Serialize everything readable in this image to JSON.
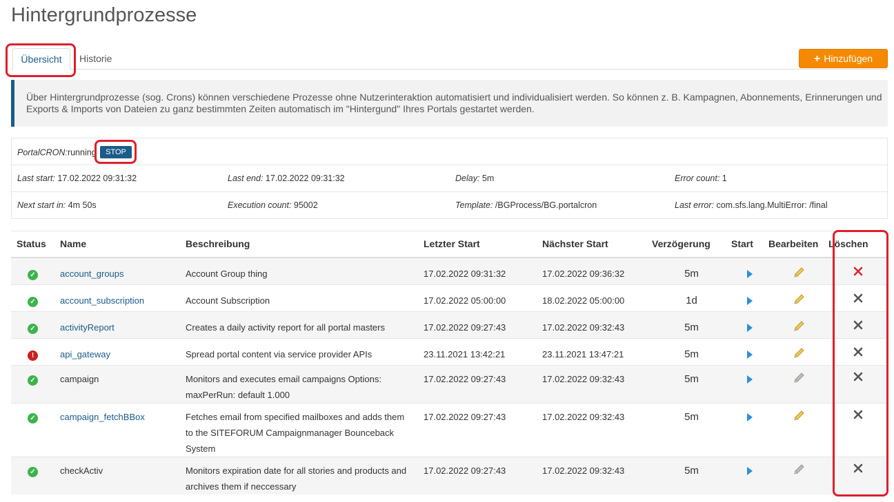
{
  "page": {
    "title": "Hintergrundprozesse"
  },
  "tabs": [
    {
      "label": "Übersicht"
    },
    {
      "label": "Historie"
    }
  ],
  "toolbar": {
    "add_label": "Hinzufügen"
  },
  "info": {
    "text": "Über Hintergrundprozesse (sog. Crons) können verschiedene Prozesse ohne Nutzerinteraktion automatisiert und individualisiert werden. So können z. B. Kampagnen, Abonnements, Erinnerungen und Exports & Imports von Dateien zu ganz bestimmten Zeiten automatisch im \"Hintergund\" Ihres Portals gestartet werden."
  },
  "cron": {
    "status_label": "PortalCRON:",
    "status_value": "running",
    "stop_label": "STOP",
    "last_start_label": "Last start:",
    "last_start": "17.02.2022 09:31:32",
    "last_end_label": "Last end:",
    "last_end": "17.02.2022 09:31:32",
    "delay_label": "Delay:",
    "delay": "5m",
    "error_count_label": "Error count:",
    "error_count": "1",
    "next_start_label": "Next start in:",
    "next_start": "4m 50s",
    "execution_count_label": "Execution count:",
    "execution_count": "95002",
    "template_label": "Template:",
    "template": "/BGProcess/BG.portalcron",
    "last_error_label": "Last error:",
    "last_error": "com.sfs.lang.MultiError: /final"
  },
  "table": {
    "columns": [
      "Status",
      "Name",
      "Beschreibung",
      "Letzter Start",
      "Nächster Start",
      "Verzögerung",
      "Start",
      "Bearbeiten",
      "Löschen"
    ],
    "rows": [
      {
        "status": "ok",
        "name": "account_groups",
        "link": true,
        "description": [
          "Account Group thing"
        ],
        "last_start": "17.02.2022 09:31:32",
        "next_start": "17.02.2022 09:36:32",
        "delay": "5m",
        "editable": true,
        "delete_active": true
      },
      {
        "status": "ok",
        "name": "account_subscription",
        "link": true,
        "description": [
          "Account Subscription"
        ],
        "last_start": "17.02.2022 05:00:00",
        "next_start": "18.02.2022 05:00:00",
        "delay": "1d",
        "editable": true,
        "delete_active": false
      },
      {
        "status": "ok",
        "name": "activityReport",
        "link": true,
        "description": [
          "Creates a daily activity report for all portal masters"
        ],
        "last_start": "17.02.2022 09:27:43",
        "next_start": "17.02.2022 09:32:43",
        "delay": "5m",
        "editable": true,
        "delete_active": false
      },
      {
        "status": "error",
        "name": "api_gateway",
        "link": true,
        "description": [
          "Spread portal content via service provider APIs"
        ],
        "last_start": "23.11.2021 13:42:21",
        "next_start": "23.11.2021 13:47:21",
        "delay": "5m",
        "editable": true,
        "delete_active": false
      },
      {
        "status": "ok",
        "name": "campaign",
        "link": false,
        "description": [
          "Monitors and executes email campaigns Options:",
          "maxPerRun: default 1.000"
        ],
        "last_start": "17.02.2022 09:27:43",
        "next_start": "17.02.2022 09:32:43",
        "delay": "5m",
        "editable": false,
        "delete_active": false
      },
      {
        "status": "ok",
        "name": "campaign_fetchBBox",
        "link": true,
        "description": [
          "Fetches email from specified mailboxes and adds them",
          "to the SITEFORUM Campaignmanager Bounceback",
          "System"
        ],
        "last_start": "17.02.2022 09:27:43",
        "next_start": "17.02.2022 09:32:43",
        "delay": "5m",
        "editable": true,
        "delete_active": false
      },
      {
        "status": "ok",
        "name": "checkActiv",
        "link": false,
        "description": [
          "Monitors expiration date for all stories and products and",
          "archives them if neccessary"
        ],
        "last_start": "17.02.2022 09:27:43",
        "next_start": "17.02.2022 09:32:43",
        "delay": "5m",
        "editable": false,
        "delete_active": false
      }
    ]
  },
  "colors": {
    "accent": "#1a5c8a",
    "add_button": "#f58a00",
    "highlight_outline": "#dd1f2b",
    "status_ok": "#3cb44b",
    "status_error": "#cc1f1f",
    "play": "#2b8ede",
    "pencil_active": "#f2c94c",
    "pencil_inactive": "#bdbdbd",
    "delete_active": "#d9262e",
    "delete_inactive": "#555555"
  },
  "icons": {
    "add": "plus-icon",
    "status_ok": "check-circle-icon",
    "status_error": "exclamation-circle-icon",
    "start": "play-icon",
    "edit": "pencil-icon",
    "delete": "close-icon"
  }
}
